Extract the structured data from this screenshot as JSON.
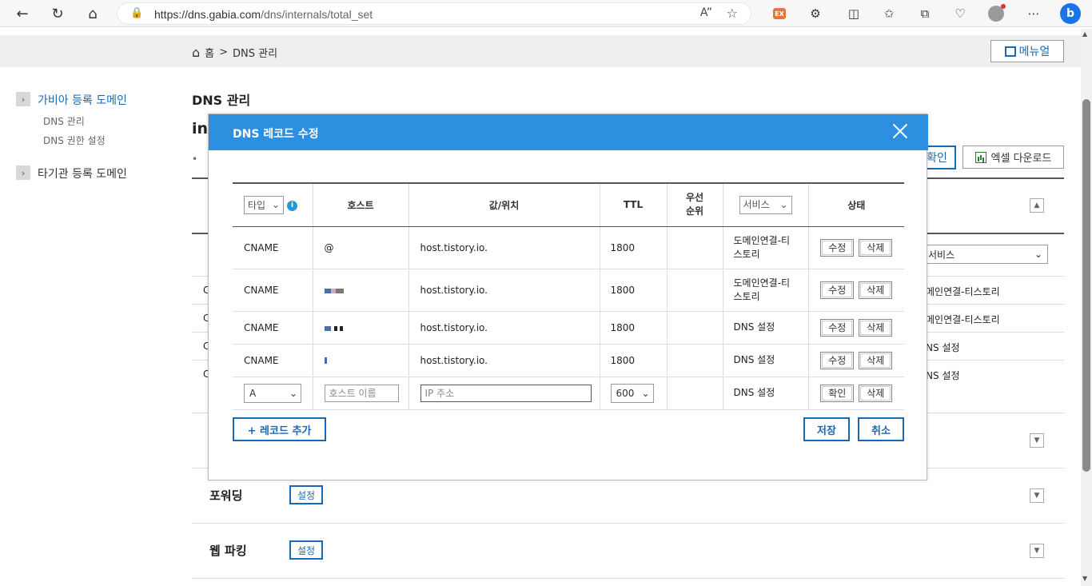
{
  "browser": {
    "url_host": "https://dns.gabia.com",
    "url_path": "/dns/internals/total_set",
    "ext_label": "EX"
  },
  "breadcrumb": {
    "home": "홈",
    "separator": ">",
    "current": "DNS 관리"
  },
  "manual_button": "메뉴얼",
  "sidebar": {
    "section1": "가비아 등록 도메인",
    "items": [
      "DNS 관리",
      "DNS 권한 설정"
    ],
    "section2": "타기관 등록 도메인"
  },
  "background": {
    "title": "DNS 관리",
    "domain_partial": "in",
    "bullet_partial": "•",
    "confirm_partial": "확인",
    "excel_button": "엑셀 다운로드",
    "service_select": "서비스",
    "row_services": [
      "메인연결-티스토리",
      "메인연결-티스토리",
      "NS 설정",
      "NS 설정"
    ],
    "row_types_partial": [
      "C",
      "C",
      "C",
      "C"
    ],
    "sections": [
      {
        "label": "포워딩",
        "button": "설정"
      },
      {
        "label": "웹 파킹",
        "button": "설정"
      }
    ]
  },
  "modal": {
    "title": "DNS 레코드 수정",
    "headers": {
      "type_select": "타입",
      "host": "호스트",
      "value": "값/위치",
      "ttl": "TTL",
      "priority_line1": "우선",
      "priority_line2": "순위",
      "service_select": "서비스",
      "status": "상태"
    },
    "rows": [
      {
        "type": "CNAME",
        "host": "@",
        "value": "host.tistory.io.",
        "ttl": "1800",
        "priority": "",
        "service_line1": "도메인연결-티",
        "service_line2": "스토리",
        "edit": "수정",
        "delete": "삭제"
      },
      {
        "type": "CNAME",
        "host": "",
        "value": "host.tistory.io.",
        "ttl": "1800",
        "priority": "",
        "service_line1": "도메인연결-티",
        "service_line2": "스토리",
        "edit": "수정",
        "delete": "삭제"
      },
      {
        "type": "CNAME",
        "host": "",
        "value": "host.tistory.io.",
        "ttl": "1800",
        "priority": "",
        "service_line1": "DNS 설정",
        "service_line2": "",
        "edit": "수정",
        "delete": "삭제"
      },
      {
        "type": "CNAME",
        "host": "",
        "value": "host.tistory.io.",
        "ttl": "1800",
        "priority": "",
        "service_line1": "DNS 설정",
        "service_line2": "",
        "edit": "수정",
        "delete": "삭제"
      }
    ],
    "new_row": {
      "type": "A",
      "host_placeholder": "호스트 이름",
      "value_placeholder": "IP 주소",
      "ttl": "600",
      "service": "DNS 설정",
      "confirm": "확인",
      "delete": "삭제"
    },
    "add_record": "+ 레코드 추가",
    "save": "저장",
    "cancel": "취소"
  },
  "colors": {
    "modal_header": "#2d8fe0",
    "accent": "#1b68b2",
    "info": "#1e9bd7"
  }
}
